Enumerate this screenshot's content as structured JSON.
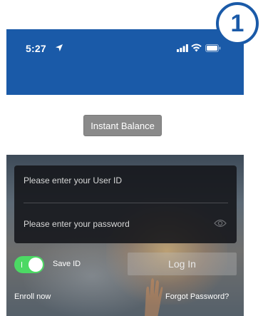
{
  "status_bar": {
    "time": "5:27",
    "icons": [
      "location-arrow-icon",
      "signal-icon",
      "wifi-icon",
      "battery-icon"
    ]
  },
  "instant_balance": {
    "label": "Instant Balance"
  },
  "login": {
    "user_id_placeholder": "Please enter your User ID",
    "user_id_value": "",
    "password_placeholder": "Please enter your password",
    "password_value": "",
    "save_id_label": "Save ID",
    "save_id_on": true,
    "login_button_label": "Log In"
  },
  "links": {
    "enroll": "Enroll now",
    "forgot_password": "Forgot Password?"
  },
  "badge": {
    "number": "1"
  },
  "colors": {
    "brand_blue": "#1a5aa8",
    "toggle_green": "#4cd964",
    "card_dark": "#14161a"
  }
}
